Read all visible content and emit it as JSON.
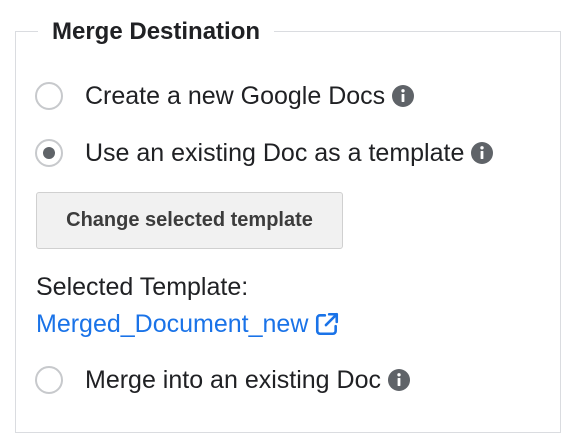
{
  "legend": "Merge Destination",
  "options": [
    {
      "label": "Create a new Google Docs",
      "checked": false,
      "icon": "info-icon"
    },
    {
      "label": "Use an existing Doc as a template",
      "checked": true,
      "icon": "info-icon"
    },
    {
      "label": "Merge into an existing Doc",
      "checked": false,
      "icon": "info-icon"
    }
  ],
  "change_template_button": "Change selected template",
  "selected_template": {
    "label": "Selected Template:",
    "name": "Merged_Document_new",
    "icon": "external-link-icon"
  },
  "colors": {
    "link": "#1a73e8",
    "icon": "#5f6368",
    "border": "#dadce0",
    "button_bg": "#f1f1f1"
  }
}
